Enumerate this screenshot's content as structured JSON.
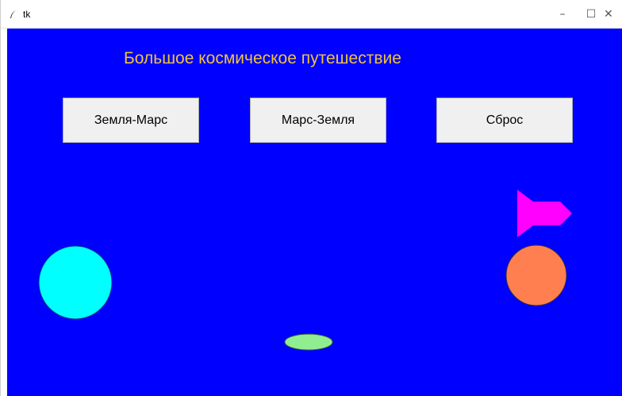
{
  "window": {
    "title": "tk",
    "controls": {
      "minimize": "–",
      "maximize": "☐",
      "close": "✕"
    }
  },
  "canvas": {
    "background": "#0000ff",
    "heading": "Большое космическое путешествие",
    "heading_color": "#f0c43a"
  },
  "buttons": {
    "earth_mars": "Земля-Марс",
    "mars_earth": "Марс-Земля",
    "reset": "Сброс"
  },
  "objects": {
    "earth_color": "#00ffff",
    "mars_color": "#ff7f50",
    "ship_color": "#ff00ff",
    "ellipse_color": "#90ee90"
  }
}
